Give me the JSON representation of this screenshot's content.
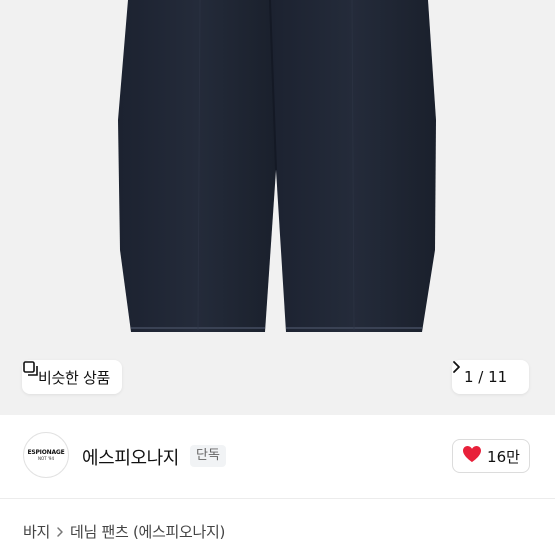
{
  "product_image": {
    "description_icon": "jeans-photo"
  },
  "image_overlay": {
    "similar_button_label": "비슷한 상품",
    "similar_icon": "copy-icon",
    "counter": "1 / 11",
    "next_icon": "chevron-right-icon"
  },
  "store": {
    "logo_text": "ESPIONAGE",
    "logo_subtext": "NOT '94",
    "name": "에스피오나지",
    "badge": "단독"
  },
  "like": {
    "icon": "heart-icon",
    "count": "16만",
    "color": "#e8203a"
  },
  "breadcrumb": {
    "items": [
      "바지",
      "데님 팬츠 (에스피오나지)"
    ],
    "separator_icon": "chevron-right-icon"
  }
}
